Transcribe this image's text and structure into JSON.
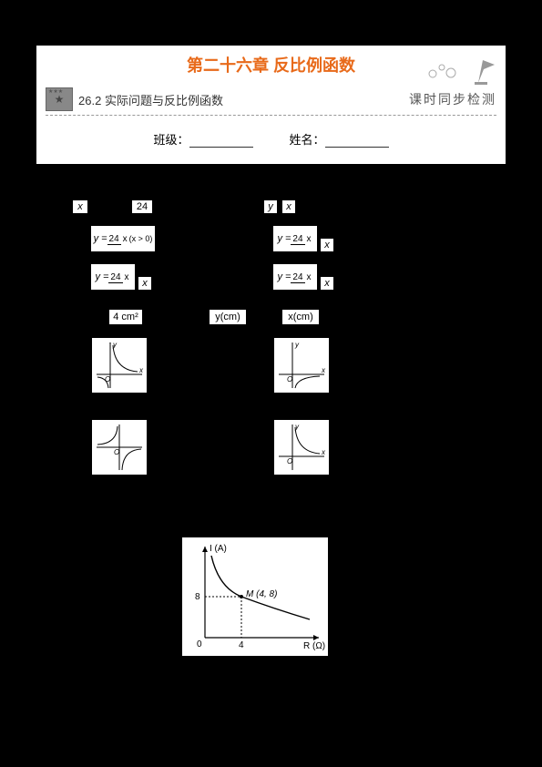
{
  "header": {
    "chapter_title": "第二十六章 反比例函数",
    "section_number": "26.2",
    "section_title": "实际问题与反比例函数",
    "keshi": "课时同步检测",
    "class_label": "班级：",
    "name_label": "姓名："
  },
  "body": {
    "x_label": "x",
    "val24": "24",
    "y_label": "y",
    "formula_A": "y = 24/x (x > 0)",
    "formula_B": "y = 24/x",
    "formula_C": "y = 24/x",
    "formula_D": "y = 24/x",
    "x_tail": "x",
    "area_label": "4 cm²",
    "ycm": "y(cm)",
    "xcm": "x(cm)",
    "graph_O": "O",
    "circuit": {
      "I_label": "I (A)",
      "R_label": "R (Ω)",
      "point_M": "M (4, 8)",
      "y_tick": "8",
      "x_tick": "4",
      "origin": "0"
    }
  }
}
